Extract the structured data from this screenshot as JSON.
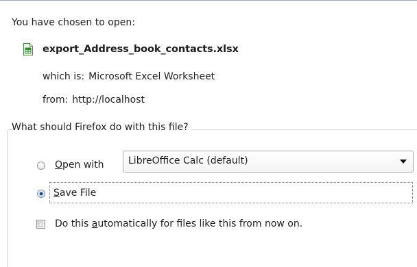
{
  "dialog": {
    "intro": "You have chosen to open:",
    "file": {
      "name": "export_Address_book_contacts.xlsx",
      "icon": "spreadsheet-file-icon"
    },
    "type": {
      "label": "which is:",
      "value": "Microsoft Excel Worksheet"
    },
    "source": {
      "label": "from:",
      "value": "http://localhost"
    },
    "action_group": {
      "legend": "What should Firefox do with this file?",
      "open_with": {
        "accesskey": "O",
        "label_rest": "pen with",
        "selected": false,
        "application": "LibreOffice Calc (default)"
      },
      "save_file": {
        "accesskey": "S",
        "label_rest": "ave File",
        "selected": true
      },
      "auto_checkbox": {
        "label_before": "Do this ",
        "accesskey": "a",
        "label_after": "utomatically for files like this from now on.",
        "checked": false
      }
    }
  },
  "colors": {
    "accent_radio": "#1c3e6f",
    "file_icon_green": "#2e8b2e"
  }
}
